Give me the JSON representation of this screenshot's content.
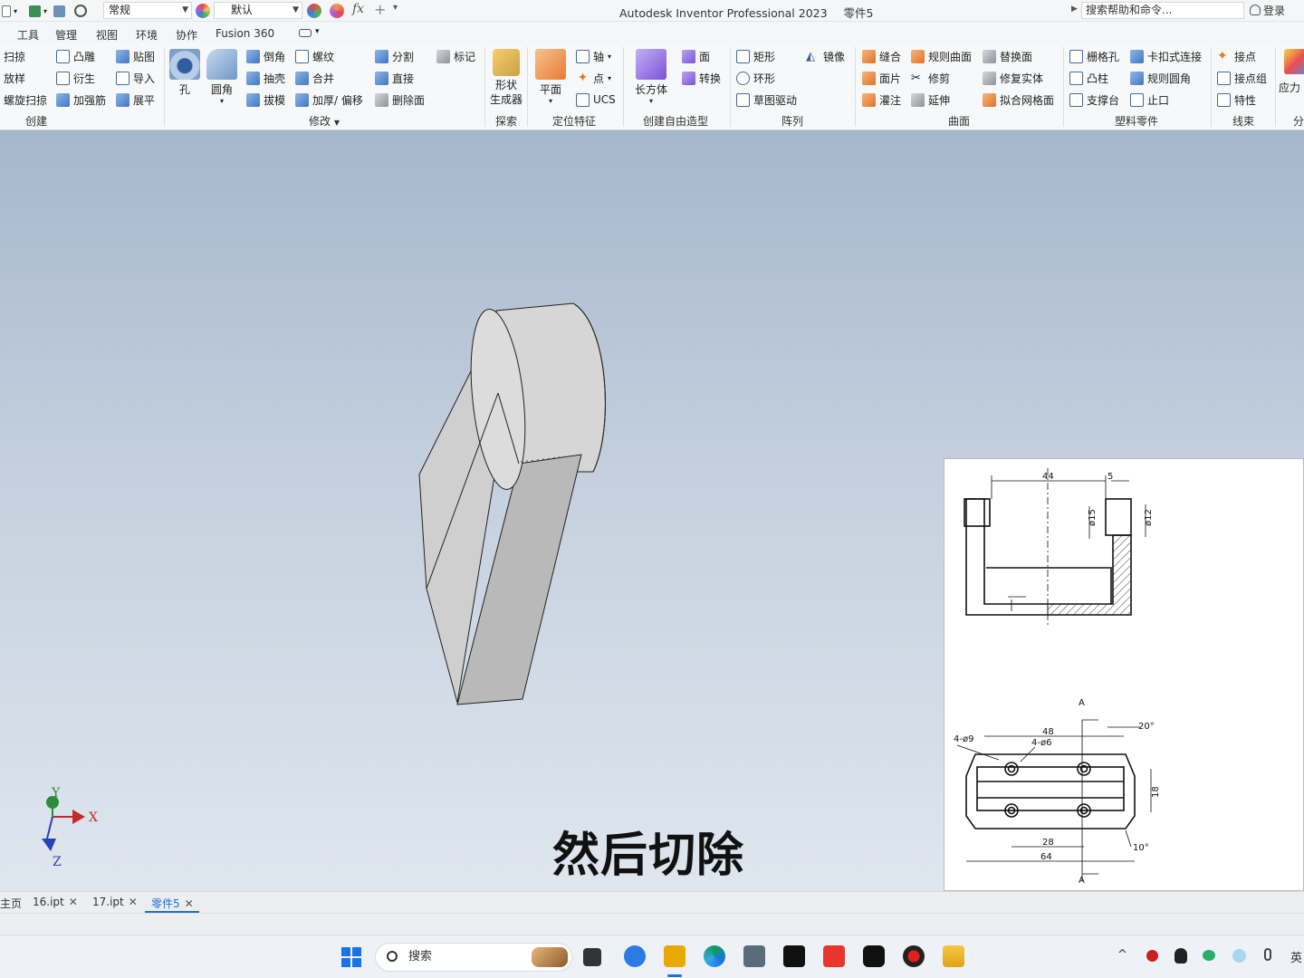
{
  "titlebar": {
    "style_combo": "常规",
    "appearance_combo": "默认",
    "app_title": "Autodesk Inventor Professional 2023",
    "doc_title": "零件5",
    "search_placeholder": "搜索帮助和命令...",
    "login": "登录",
    "fx": "fx"
  },
  "tabs": [
    "工具",
    "管理",
    "视图",
    "环境",
    "协作",
    "Fusion 360"
  ],
  "ribbon": {
    "create": {
      "label": "创建",
      "items": [
        "扫掠",
        "放样",
        "螺旋扫掠",
        "凸雕",
        "衍生",
        "加强筋",
        "贴图",
        "导入",
        "展平"
      ]
    },
    "modify": {
      "label": "修改",
      "big": [
        "孔",
        "圆角"
      ],
      "items": [
        "倒角",
        "抽壳",
        "拔模",
        "螺纹",
        "合并",
        "加厚/ 偏移",
        "分割",
        "直接",
        "删除面",
        "标记"
      ]
    },
    "explore": {
      "label": "探索",
      "big": "形状\n生成器"
    },
    "work": {
      "label": "定位特征",
      "big": "平面",
      "items": [
        "轴",
        "点",
        "UCS"
      ]
    },
    "freeform": {
      "label": "创建自由造型",
      "big": "长方体",
      "items": [
        "面",
        "转换"
      ]
    },
    "pattern": {
      "label": "阵列",
      "items": [
        "矩形",
        "环形",
        "草图驱动",
        "镜像"
      ]
    },
    "surface": {
      "label": "曲面",
      "items": [
        "缝合",
        "面片",
        "灌注",
        "规则曲面",
        "修剪",
        "延伸",
        "替换面",
        "修复实体",
        "拟合网格面"
      ]
    },
    "plastic": {
      "label": "塑料零件",
      "items": [
        "栅格孔",
        "凸柱",
        "支撑台",
        "卡扣式连接",
        "规则圆角",
        "止口"
      ]
    },
    "harness": {
      "label": "线束",
      "items": [
        "接点",
        "接点组",
        "特性"
      ]
    },
    "stress": {
      "label": "分",
      "big": "应力"
    }
  },
  "viewport": {
    "subtitle": "然后切除",
    "axes": {
      "x": "X",
      "y": "Y",
      "z": "Z"
    },
    "drawing": {
      "dims_top": [
        "44",
        "5",
        "ø15",
        "ø12"
      ],
      "dims_bottom": [
        "A",
        "20°",
        "4-ø9",
        "4-ø6",
        "48",
        "18",
        "28",
        "64",
        "10°",
        "A"
      ]
    }
  },
  "doc_tabs": [
    {
      "label": "主页",
      "closable": false,
      "active": false
    },
    {
      "label": "16.ipt",
      "closable": true,
      "active": false
    },
    {
      "label": "17.ipt",
      "closable": true,
      "active": false
    },
    {
      "label": "零件5",
      "closable": true,
      "active": true
    }
  ],
  "taskbar": {
    "search": "搜索",
    "lang": "英"
  }
}
